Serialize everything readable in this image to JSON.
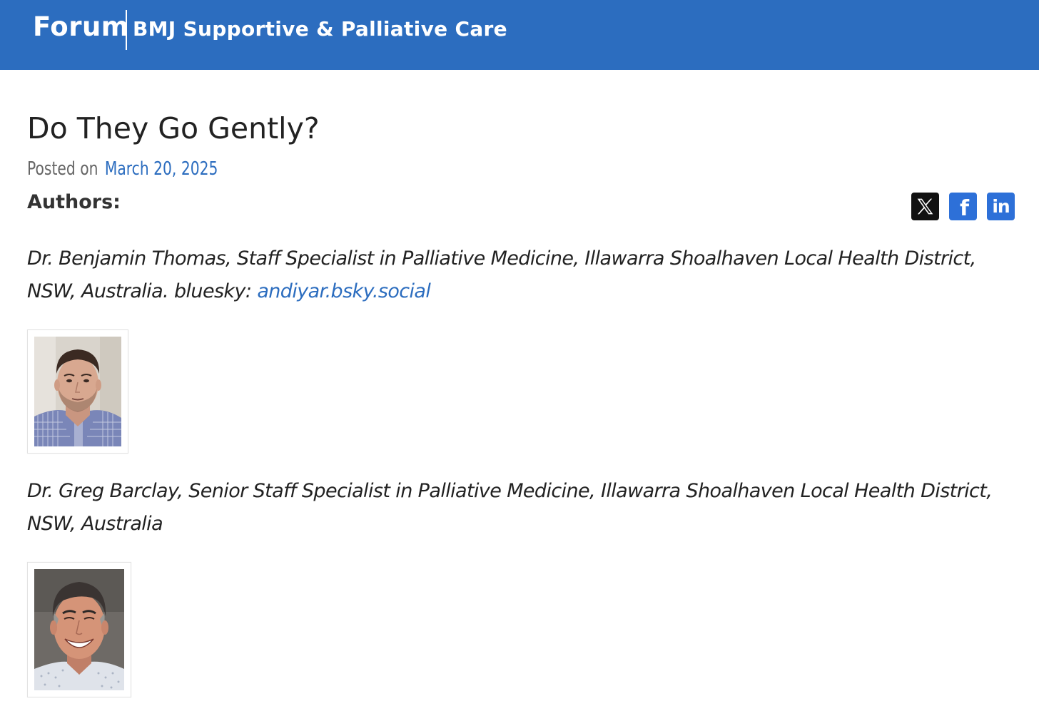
{
  "header": {
    "brand_forum": "Forum",
    "brand_journal": "BMJ Supportive & Palliative Care",
    "background_color": "#2c6dbf"
  },
  "post": {
    "title": "Do They Go Gently?",
    "posted_label": "Posted on",
    "posted_date": "March 20, 2025",
    "authors_heading": "Authors:"
  },
  "share": {
    "icons": [
      "x-twitter-icon",
      "facebook-icon",
      "linkedin-icon"
    ],
    "x_glyph": "X",
    "facebook_glyph": "f",
    "linkedin_glyph": "in"
  },
  "authors": [
    {
      "description": "Dr. Benjamin Thomas, Staff Specialist in Palliative Medicine, Illawarra Shoalhaven Local Health District, NSW, Australia. bluesky: ",
      "link_text": "andiyar.bsky.social"
    },
    {
      "description": "Dr. Greg Barclay, Senior Staff Specialist in Palliative Medicine, Illawarra Shoalhaven Local Health District, NSW, Australia"
    }
  ],
  "colors": {
    "link": "#2c6dbf",
    "x_button": "#111111",
    "social_button": "#2d70d8"
  }
}
